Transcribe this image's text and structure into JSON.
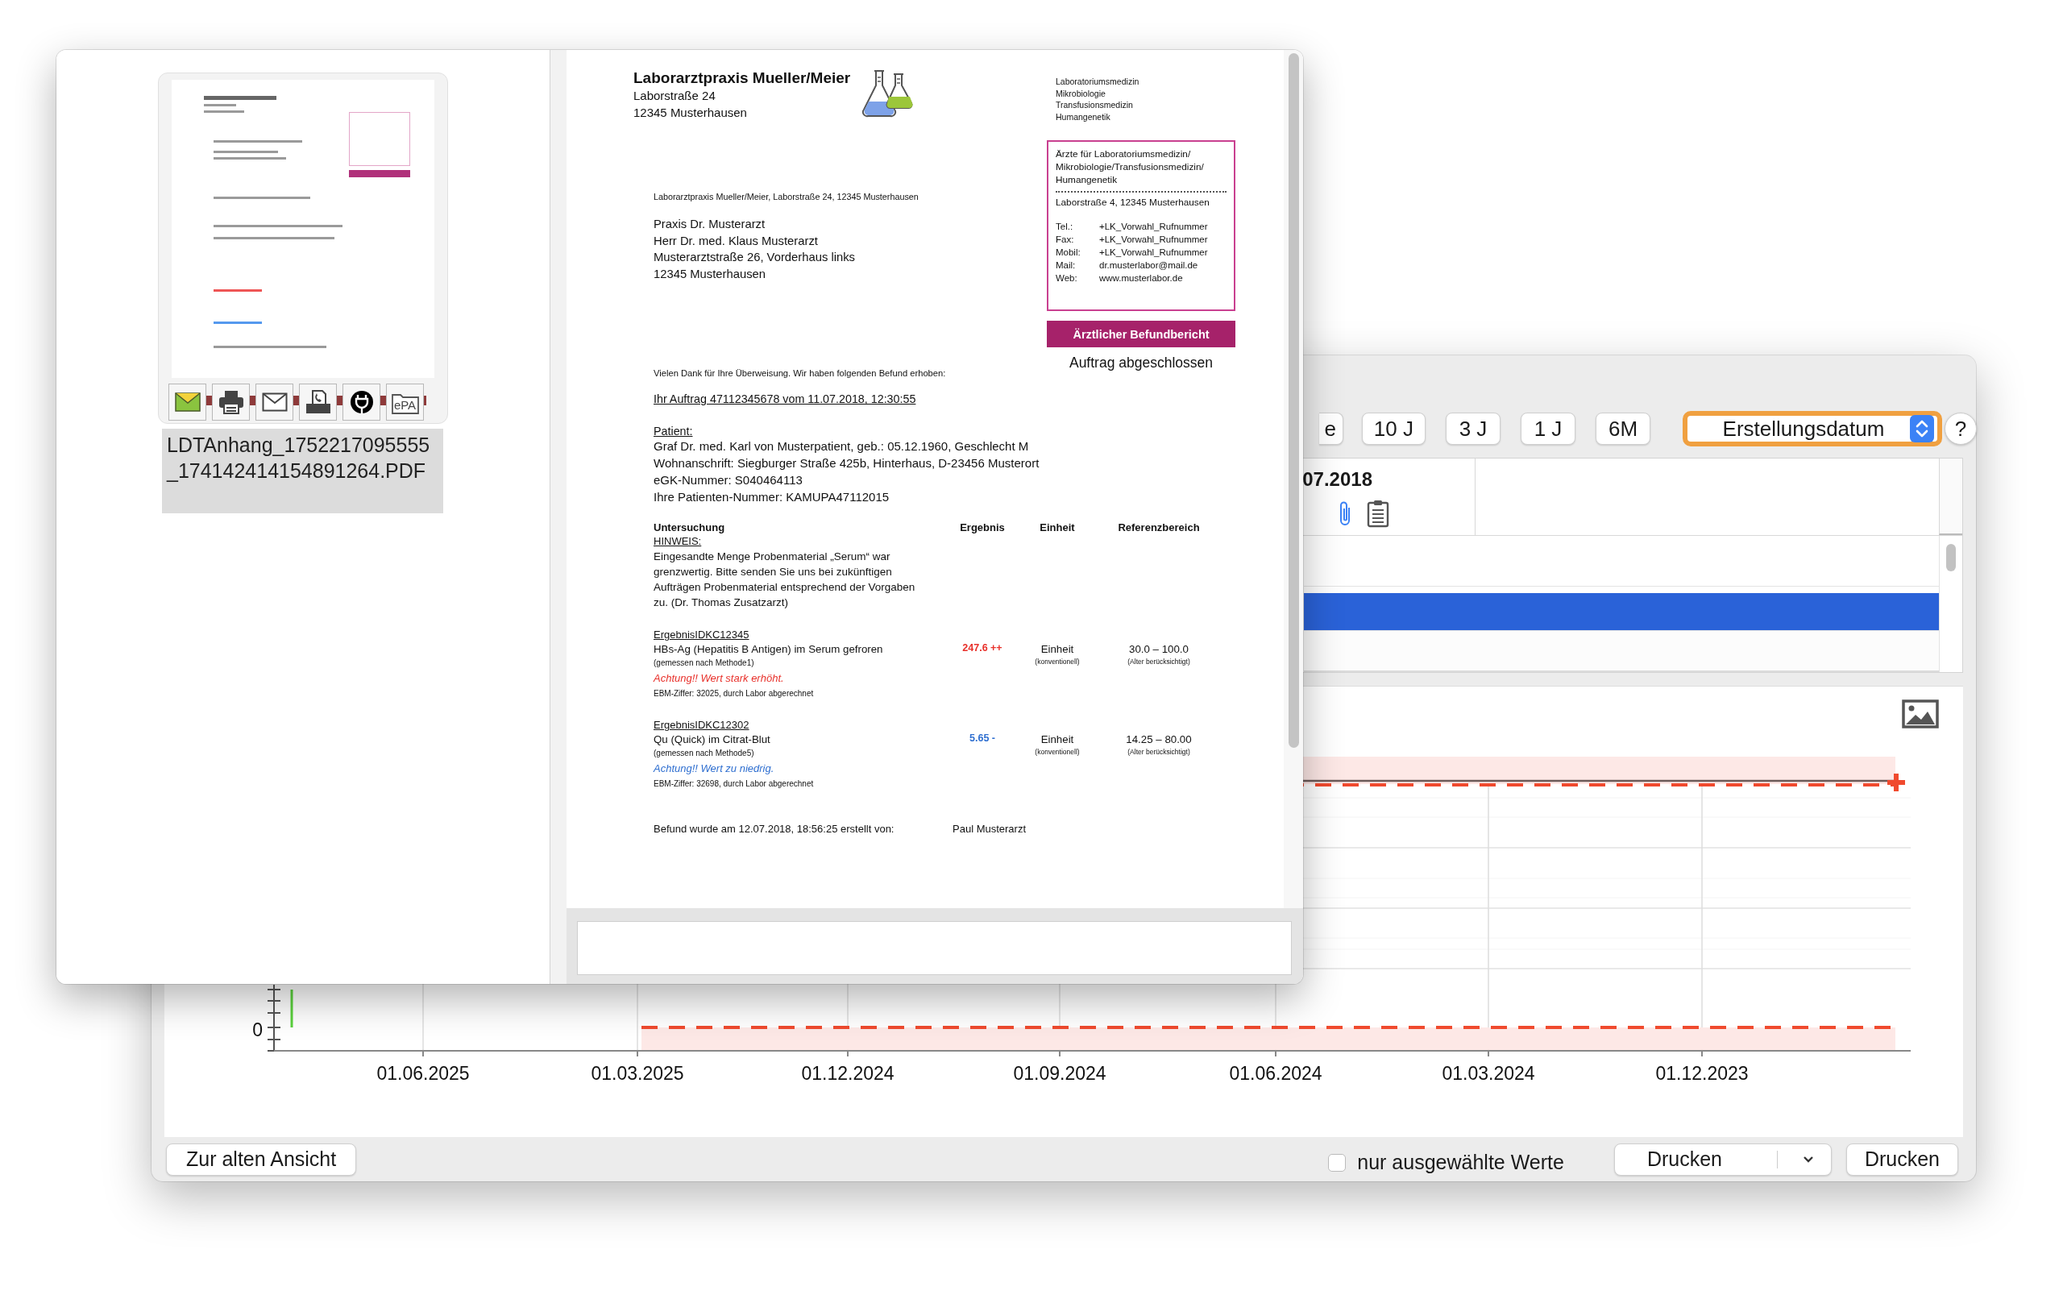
{
  "back_window": {
    "toolbar": {
      "range_buttons": [
        {
          "label": "e"
        },
        {
          "label": "10 J"
        },
        {
          "label": "3 J"
        },
        {
          "label": "1 J"
        },
        {
          "label": "6M"
        }
      ],
      "sort_select": {
        "value": "Erstellungsdatum",
        "focused": true
      },
      "help_button": "?"
    },
    "table": {
      "header": "07.2018",
      "rows": [
        {
          "selected": false
        },
        {
          "selected": true
        },
        {
          "selected": false
        }
      ]
    },
    "chart": {
      "y_tick_labels": [
        "0"
      ],
      "x_tick_labels": [
        "01.06.2025",
        "01.03.2025",
        "01.12.2024",
        "01.09.2024",
        "01.06.2024",
        "01.03.2024",
        "01.12.2023"
      ]
    },
    "footer": {
      "old_view_button": "Zur alten Ansicht",
      "only_selected": {
        "label": "nur ausgewählte Werte",
        "checked": false
      },
      "print_menu": "Drucken",
      "print_button": "Drucken"
    }
  },
  "preview_window": {
    "attachments": [
      {
        "filename": "LDTAnhang_1752217095555_174142414154891264.PDF",
        "selected": true,
        "actions": [
          {
            "kind": "mail-colored"
          },
          {
            "kind": "printer"
          },
          {
            "kind": "envelope"
          },
          {
            "kind": "fax"
          },
          {
            "kind": "plug"
          },
          {
            "kind": "epa",
            "label": "ePA"
          }
        ]
      }
    ],
    "document": {
      "letterhead": {
        "name": "Laborarztpraxis Mueller/Meier",
        "address": [
          "Laborstraße 24",
          "12345 Musterhausen"
        ],
        "specialties": [
          "Laboratoriumsmedizin",
          "Mikrobiologie",
          "Transfusionsmedizin",
          "Humangenetik"
        ]
      },
      "sender_line": "Laborarztpraxis Mueller/Meier, Laborstraße 24, 12345 Musterhausen",
      "recipient": [
        "Praxis Dr. Musterarzt",
        "Herr Dr. med. Klaus Musterarzt",
        "Musterarztstraße 26, Vorderhaus links",
        "12345 Musterhausen"
      ],
      "contact_box": {
        "title_lines": [
          "Ärzte für Laboratoriumsmedizin/",
          "Mikrobiologie/Transfusionsmedizin/",
          "Humangenetik"
        ],
        "address": "Laborstraße 4, 12345 Musterhausen",
        "contacts": [
          {
            "label": "Tel.:",
            "value": "+LK_Vorwahl_Rufnummer"
          },
          {
            "label": "Fax:",
            "value": "+LK_Vorwahl_Rufnummer"
          },
          {
            "label": "Mobil:",
            "value": "+LK_Vorwahl_Rufnummer"
          },
          {
            "label": "Mail:",
            "value": "dr.musterlabor@mail.de"
          },
          {
            "label": "Web:",
            "value": "www.musterlabor.de"
          }
        ]
      },
      "report_badge": "Ärztlicher Befundbericht",
      "order_status": "Auftrag abgeschlossen",
      "intro": "Vielen Dank für Ihre Überweisung. Wir haben folgenden Befund erhoben:",
      "order_line": "Ihr Auftrag 47112345678 vom 11.07.2018, 12:30:55",
      "patient": {
        "heading": "Patient:",
        "lines": [
          "Graf Dr. med. Karl von Musterpatient, geb.: 05.12.1960, Geschlecht M",
          "Wohnanschrift: Siegburger Straße 425b, Hinterhaus, D-23456 Musterort",
          "eGK-Nummer: S040464113",
          "Ihre Patienten-Nummer: KAMUPA47112015"
        ]
      },
      "results_table": {
        "columns": [
          "Untersuchung",
          "Ergebnis",
          "Einheit",
          "Referenzbereich"
        ],
        "note": {
          "heading": "HINWEIS:",
          "text": "Eingesandte Menge Probenmaterial „Serum“ war grenzwertig. Bitte senden Sie uns bei zukünftigen Aufträgen Probenmaterial entsprechend der Vorgaben zu. (Dr. Thomas Zusatzarzt)"
        },
        "results": [
          {
            "id": "ErgebnisIDKC12345",
            "test": "HBs-Ag (Hepatitis B Antigen) im Serum gefroren",
            "method": "(gemessen nach Methode1)",
            "value": "247.6 ++",
            "color": "#e8302a",
            "unit": "Einheit",
            "unit_note": "(konventionell)",
            "range": "30.0 – 100.0",
            "range_note": "(Alter berücksichtigt)",
            "warning": "Achtung!! Wert stark erhöht.",
            "billing": "EBM-Ziffer: 32025, durch Labor abgerechnet"
          },
          {
            "id": "ErgebnisIDKC12302",
            "test": "Qu (Quick) im Citrat-Blut",
            "method": "(gemessen nach Methode5)",
            "value": "5.65 -",
            "color": "#2f6fd0",
            "unit": "Einheit",
            "unit_note": "(konventionell)",
            "range": "14.25 – 80.00",
            "range_note": "(Alter berücksichtigt)",
            "warning": "Achtung!! Wert zu niedrig.",
            "billing": "EBM-Ziffer: 32698, durch Labor abgerechnet"
          }
        ]
      },
      "signature": {
        "text": "Befund wurde am 12.07.2018, 18:56:25 erstellt von:",
        "author": "Paul Musterarzt"
      }
    }
  }
}
